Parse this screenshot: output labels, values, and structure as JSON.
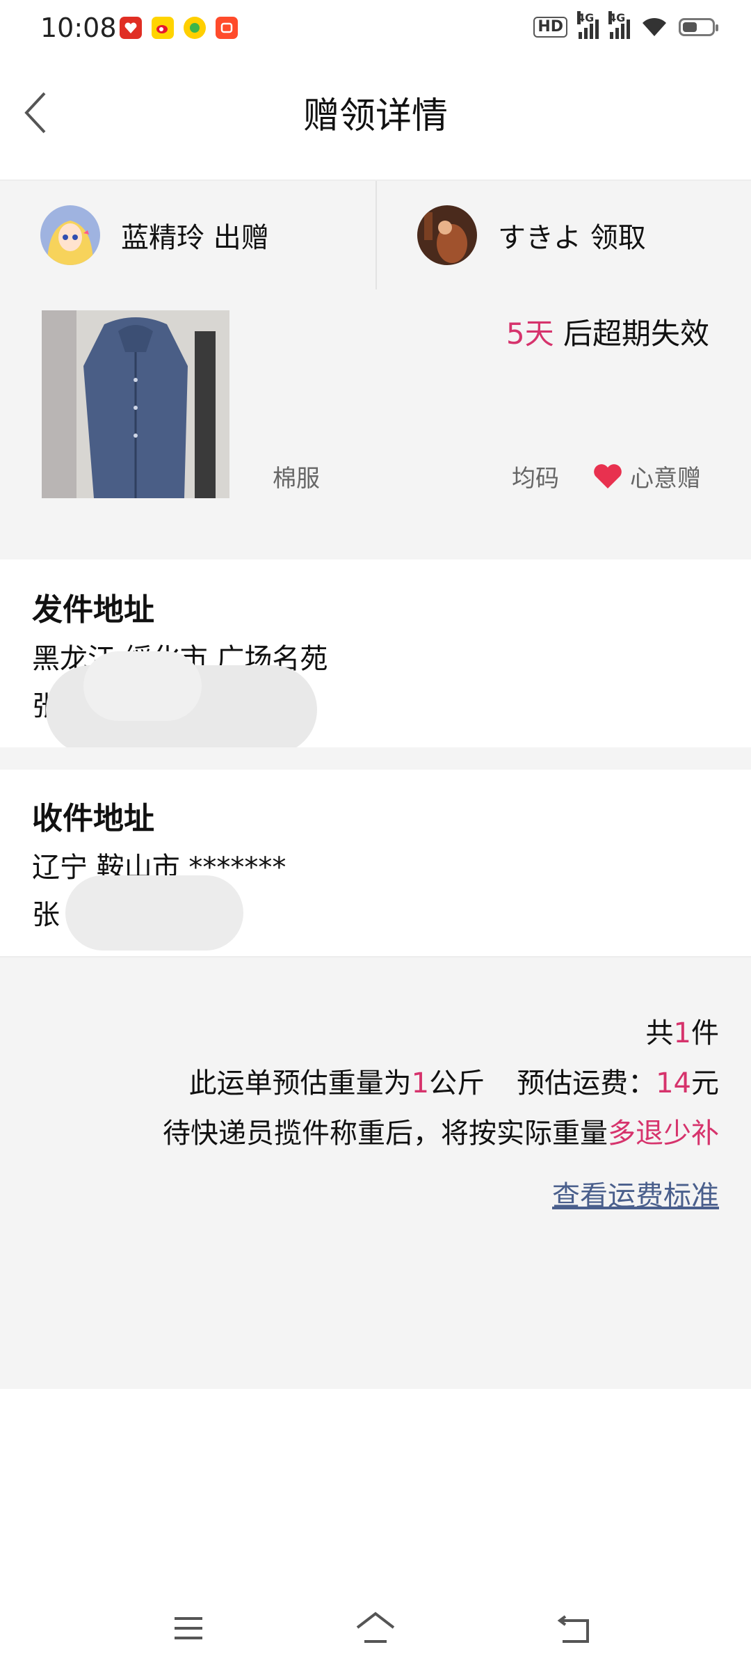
{
  "status_bar": {
    "time": "10:08",
    "hd_label": "HD",
    "hd_sub": "1 2",
    "net1": "4G",
    "net2": "4G",
    "app_icons": [
      "pinduoduo-icon",
      "weibo-icon",
      "taobao-icon",
      "kuaishou-icon"
    ],
    "battery_level_pct": 55
  },
  "header": {
    "title": "赠领详情",
    "back_icon": "chevron-left-icon"
  },
  "users": {
    "giver": "蓝精玲 出赠",
    "receiver": "すきよ 领取"
  },
  "item": {
    "expire_days": "5天",
    "expire_suffix": " 后超期失效",
    "name": "棉服",
    "size": "均码",
    "gift_type": "心意赠"
  },
  "send_address": {
    "heading": "发件地址",
    "line1": "黑龙江 绥化市 广场名苑",
    "line2": "张                       2"
  },
  "receive_address": {
    "heading": "收件地址",
    "line1": "辽宁 鞍山市 *******",
    "line2": "张              7172"
  },
  "shipping": {
    "count_prefix": "共",
    "count": "1",
    "count_suffix": "件",
    "weight_prefix": "此运单预估重量为",
    "weight": "1",
    "weight_suffix": "公斤",
    "fee_prefix": "预估运费：",
    "fee": "14",
    "fee_suffix": "元",
    "note_prefix": "待快递员揽件称重后，将按实际重量",
    "note_highlight": "多退少补",
    "link": "查看运费标准"
  },
  "colors": {
    "accent": "#d6336c",
    "link": "#4a5f8c",
    "section_bg": "#f4f4f4"
  }
}
